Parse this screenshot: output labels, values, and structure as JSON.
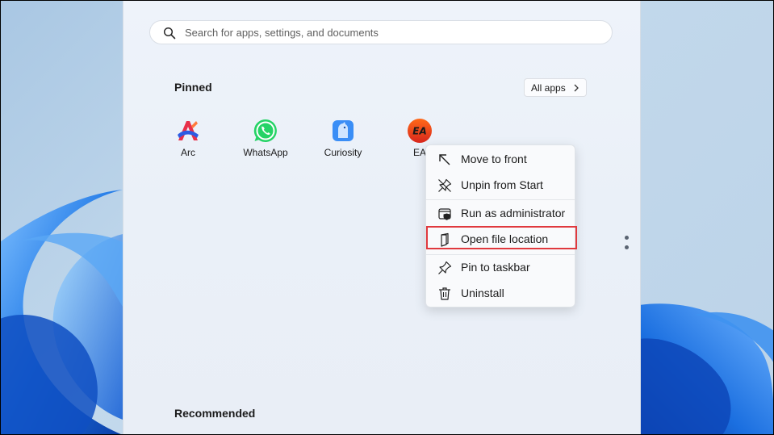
{
  "search": {
    "placeholder": "Search for apps, settings, and documents",
    "icon": "search-icon"
  },
  "pinned": {
    "title": "Pinned",
    "all_apps_label": "All apps",
    "apps": [
      {
        "label": "Arc",
        "icon": "arc-icon"
      },
      {
        "label": "WhatsApp",
        "icon": "whatsapp-icon"
      },
      {
        "label": "Curiosity",
        "icon": "curiosity-icon"
      },
      {
        "label": "EA",
        "icon": "ea-icon",
        "icon_text": "EA"
      }
    ]
  },
  "context_menu": {
    "items": [
      {
        "label": "Move to front",
        "icon": "move-to-front-icon"
      },
      {
        "label": "Unpin from Start",
        "icon": "unpin-icon"
      },
      {
        "label": "Run as administrator",
        "icon": "shield-icon"
      },
      {
        "label": "Open file location",
        "icon": "file-location-icon",
        "highlighted": true
      },
      {
        "label": "Pin to taskbar",
        "icon": "pin-icon"
      },
      {
        "label": "Uninstall",
        "icon": "trash-icon"
      }
    ]
  },
  "recommended": {
    "title": "Recommended"
  },
  "colors": {
    "highlight_border": "#e0393e",
    "whatsapp_green": "#25d366",
    "ea_orange": "#f04b1d",
    "wallpaper_blue": "#1e6fd9"
  }
}
